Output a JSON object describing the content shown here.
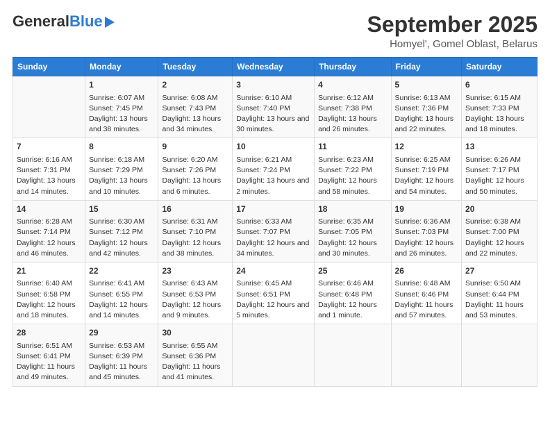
{
  "logo": {
    "general": "General",
    "blue": "Blue"
  },
  "header": {
    "title": "September 2025",
    "subtitle": "Homyel', Gomel Oblast, Belarus"
  },
  "days_of_week": [
    "Sunday",
    "Monday",
    "Tuesday",
    "Wednesday",
    "Thursday",
    "Friday",
    "Saturday"
  ],
  "weeks": [
    [
      {
        "day": "",
        "sunrise": "",
        "sunset": "",
        "daylight": ""
      },
      {
        "day": "1",
        "sunrise": "Sunrise: 6:07 AM",
        "sunset": "Sunset: 7:45 PM",
        "daylight": "Daylight: 13 hours and 38 minutes."
      },
      {
        "day": "2",
        "sunrise": "Sunrise: 6:08 AM",
        "sunset": "Sunset: 7:43 PM",
        "daylight": "Daylight: 13 hours and 34 minutes."
      },
      {
        "day": "3",
        "sunrise": "Sunrise: 6:10 AM",
        "sunset": "Sunset: 7:40 PM",
        "daylight": "Daylight: 13 hours and 30 minutes."
      },
      {
        "day": "4",
        "sunrise": "Sunrise: 6:12 AM",
        "sunset": "Sunset: 7:38 PM",
        "daylight": "Daylight: 13 hours and 26 minutes."
      },
      {
        "day": "5",
        "sunrise": "Sunrise: 6:13 AM",
        "sunset": "Sunset: 7:36 PM",
        "daylight": "Daylight: 13 hours and 22 minutes."
      },
      {
        "day": "6",
        "sunrise": "Sunrise: 6:15 AM",
        "sunset": "Sunset: 7:33 PM",
        "daylight": "Daylight: 13 hours and 18 minutes."
      }
    ],
    [
      {
        "day": "7",
        "sunrise": "Sunrise: 6:16 AM",
        "sunset": "Sunset: 7:31 PM",
        "daylight": "Daylight: 13 hours and 14 minutes."
      },
      {
        "day": "8",
        "sunrise": "Sunrise: 6:18 AM",
        "sunset": "Sunset: 7:29 PM",
        "daylight": "Daylight: 13 hours and 10 minutes."
      },
      {
        "day": "9",
        "sunrise": "Sunrise: 6:20 AM",
        "sunset": "Sunset: 7:26 PM",
        "daylight": "Daylight: 13 hours and 6 minutes."
      },
      {
        "day": "10",
        "sunrise": "Sunrise: 6:21 AM",
        "sunset": "Sunset: 7:24 PM",
        "daylight": "Daylight: 13 hours and 2 minutes."
      },
      {
        "day": "11",
        "sunrise": "Sunrise: 6:23 AM",
        "sunset": "Sunset: 7:22 PM",
        "daylight": "Daylight: 12 hours and 58 minutes."
      },
      {
        "day": "12",
        "sunrise": "Sunrise: 6:25 AM",
        "sunset": "Sunset: 7:19 PM",
        "daylight": "Daylight: 12 hours and 54 minutes."
      },
      {
        "day": "13",
        "sunrise": "Sunrise: 6:26 AM",
        "sunset": "Sunset: 7:17 PM",
        "daylight": "Daylight: 12 hours and 50 minutes."
      }
    ],
    [
      {
        "day": "14",
        "sunrise": "Sunrise: 6:28 AM",
        "sunset": "Sunset: 7:14 PM",
        "daylight": "Daylight: 12 hours and 46 minutes."
      },
      {
        "day": "15",
        "sunrise": "Sunrise: 6:30 AM",
        "sunset": "Sunset: 7:12 PM",
        "daylight": "Daylight: 12 hours and 42 minutes."
      },
      {
        "day": "16",
        "sunrise": "Sunrise: 6:31 AM",
        "sunset": "Sunset: 7:10 PM",
        "daylight": "Daylight: 12 hours and 38 minutes."
      },
      {
        "day": "17",
        "sunrise": "Sunrise: 6:33 AM",
        "sunset": "Sunset: 7:07 PM",
        "daylight": "Daylight: 12 hours and 34 minutes."
      },
      {
        "day": "18",
        "sunrise": "Sunrise: 6:35 AM",
        "sunset": "Sunset: 7:05 PM",
        "daylight": "Daylight: 12 hours and 30 minutes."
      },
      {
        "day": "19",
        "sunrise": "Sunrise: 6:36 AM",
        "sunset": "Sunset: 7:03 PM",
        "daylight": "Daylight: 12 hours and 26 minutes."
      },
      {
        "day": "20",
        "sunrise": "Sunrise: 6:38 AM",
        "sunset": "Sunset: 7:00 PM",
        "daylight": "Daylight: 12 hours and 22 minutes."
      }
    ],
    [
      {
        "day": "21",
        "sunrise": "Sunrise: 6:40 AM",
        "sunset": "Sunset: 6:58 PM",
        "daylight": "Daylight: 12 hours and 18 minutes."
      },
      {
        "day": "22",
        "sunrise": "Sunrise: 6:41 AM",
        "sunset": "Sunset: 6:55 PM",
        "daylight": "Daylight: 12 hours and 14 minutes."
      },
      {
        "day": "23",
        "sunrise": "Sunrise: 6:43 AM",
        "sunset": "Sunset: 6:53 PM",
        "daylight": "Daylight: 12 hours and 9 minutes."
      },
      {
        "day": "24",
        "sunrise": "Sunrise: 6:45 AM",
        "sunset": "Sunset: 6:51 PM",
        "daylight": "Daylight: 12 hours and 5 minutes."
      },
      {
        "day": "25",
        "sunrise": "Sunrise: 6:46 AM",
        "sunset": "Sunset: 6:48 PM",
        "daylight": "Daylight: 12 hours and 1 minute."
      },
      {
        "day": "26",
        "sunrise": "Sunrise: 6:48 AM",
        "sunset": "Sunset: 6:46 PM",
        "daylight": "Daylight: 11 hours and 57 minutes."
      },
      {
        "day": "27",
        "sunrise": "Sunrise: 6:50 AM",
        "sunset": "Sunset: 6:44 PM",
        "daylight": "Daylight: 11 hours and 53 minutes."
      }
    ],
    [
      {
        "day": "28",
        "sunrise": "Sunrise: 6:51 AM",
        "sunset": "Sunset: 6:41 PM",
        "daylight": "Daylight: 11 hours and 49 minutes."
      },
      {
        "day": "29",
        "sunrise": "Sunrise: 6:53 AM",
        "sunset": "Sunset: 6:39 PM",
        "daylight": "Daylight: 11 hours and 45 minutes."
      },
      {
        "day": "30",
        "sunrise": "Sunrise: 6:55 AM",
        "sunset": "Sunset: 6:36 PM",
        "daylight": "Daylight: 11 hours and 41 minutes."
      },
      {
        "day": "",
        "sunrise": "",
        "sunset": "",
        "daylight": ""
      },
      {
        "day": "",
        "sunrise": "",
        "sunset": "",
        "daylight": ""
      },
      {
        "day": "",
        "sunrise": "",
        "sunset": "",
        "daylight": ""
      },
      {
        "day": "",
        "sunrise": "",
        "sunset": "",
        "daylight": ""
      }
    ]
  ]
}
